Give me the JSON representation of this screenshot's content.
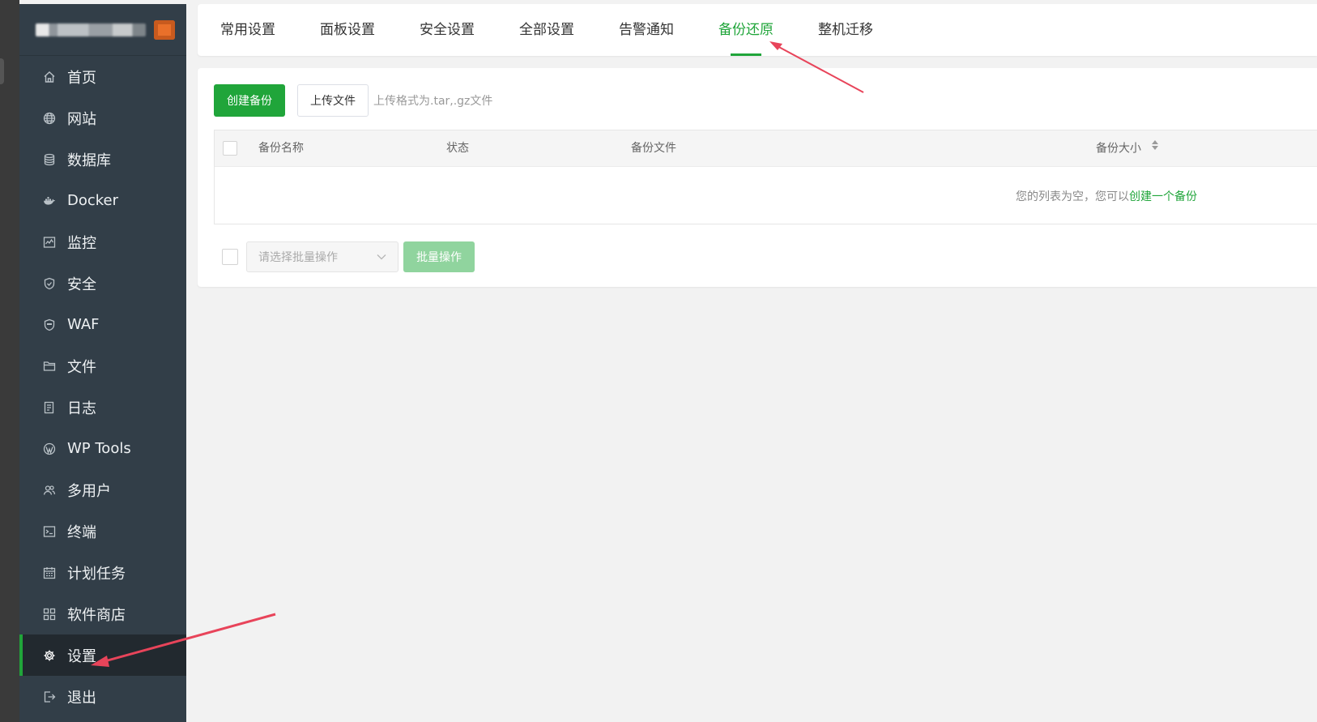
{
  "sidebar": {
    "items": [
      {
        "label": "首页",
        "icon": "home-icon"
      },
      {
        "label": "网站",
        "icon": "globe-icon"
      },
      {
        "label": "数据库",
        "icon": "database-icon"
      },
      {
        "label": "Docker",
        "icon": "docker-icon"
      },
      {
        "label": "监控",
        "icon": "monitor-icon"
      },
      {
        "label": "安全",
        "icon": "shield-icon"
      },
      {
        "label": "WAF",
        "icon": "waf-shield-icon"
      },
      {
        "label": "文件",
        "icon": "folder-icon"
      },
      {
        "label": "日志",
        "icon": "log-icon"
      },
      {
        "label": "WP Tools",
        "icon": "wordpress-icon"
      },
      {
        "label": "多用户",
        "icon": "users-icon"
      },
      {
        "label": "终端",
        "icon": "terminal-icon"
      },
      {
        "label": "计划任务",
        "icon": "calendar-icon"
      },
      {
        "label": "软件商店",
        "icon": "grid-icon"
      },
      {
        "label": "设置",
        "icon": "gear-icon"
      },
      {
        "label": "退出",
        "icon": "logout-icon"
      }
    ],
    "active_index": 14
  },
  "tabs": [
    {
      "label": "常用设置"
    },
    {
      "label": "面板设置"
    },
    {
      "label": "安全设置"
    },
    {
      "label": "全部设置"
    },
    {
      "label": "告警通知"
    },
    {
      "label": "备份还原"
    },
    {
      "label": "整机迁移"
    }
  ],
  "active_tab_index": 5,
  "toolbar": {
    "create_label": "创建备份",
    "upload_label": "上传文件",
    "upload_hint": "上传格式为.tar,.gz文件"
  },
  "table": {
    "columns": [
      "备份名称",
      "状态",
      "备份文件",
      "备份大小"
    ],
    "rows": [],
    "empty_prefix": "您的列表为空，您可以",
    "empty_link": "创建一个备份"
  },
  "batch": {
    "select_placeholder": "请选择批量操作",
    "button_label": "批量操作"
  },
  "colors": {
    "accent": "#20a53a",
    "sidebar_bg": "#323e48",
    "annotation_arrow": "#e8445a"
  }
}
